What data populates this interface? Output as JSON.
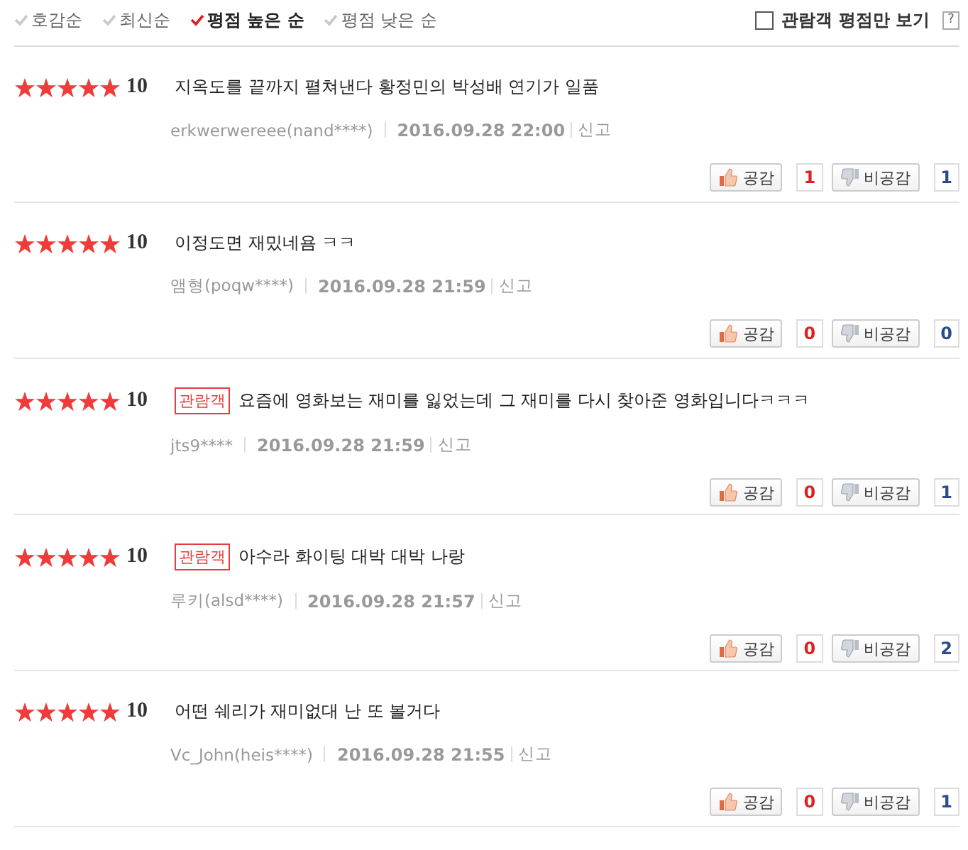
{
  "sort_options": [
    {
      "label": "호감순",
      "selected": false
    },
    {
      "label": "최신순",
      "selected": false
    },
    {
      "label": "평점 높은 순",
      "selected": true
    },
    {
      "label": "평점 낮은 순",
      "selected": false
    }
  ],
  "filter": {
    "label": "관람객 평점만 보기",
    "checked": false,
    "help": "?"
  },
  "reviews": [
    {
      "stars": 5,
      "score": "10",
      "text": "지옥도를 끝까지 펼쳐낸다 황정민의 박성배 연기가 일품",
      "author": "erkwerwereee(nand****)",
      "date": "2016.09.28 22:00",
      "report": "신고",
      "like_label": "공감",
      "likes": "1",
      "dislike_label": "비공감",
      "dislikes": "1"
    },
    {
      "stars": 5,
      "score": "10",
      "text": "이정도면 재밌네욤 ㅋㅋ",
      "author": "앰형(poqw****)",
      "date": "2016.09.28 21:59",
      "report": "신고",
      "like_label": "공감",
      "likes": "0",
      "dislike_label": "비공감",
      "dislikes": "0"
    },
    {
      "stars": 5,
      "score": "10",
      "badge": "관람객",
      "text": "요즘에 영화보는 재미를 잃었는데 그 재미를 다시 찾아준 영화입니다ㅋㅋㅋ",
      "author": "jts9****",
      "date": "2016.09.28 21:59",
      "report": "신고",
      "like_label": "공감",
      "likes": "0",
      "dislike_label": "비공감",
      "dislikes": "1"
    },
    {
      "stars": 5,
      "score": "10",
      "badge": "관람객",
      "text": "아수라 화이팅 대박 대박 나랑",
      "author": "루키(alsd****)",
      "date": "2016.09.28 21:57",
      "report": "신고",
      "like_label": "공감",
      "likes": "0",
      "dislike_label": "비공감",
      "dislikes": "2"
    },
    {
      "stars": 5,
      "score": "10",
      "text": "어떤 쉐리가 재미없대 난 또 볼거다",
      "author": "Vc_John(heis****)",
      "date": "2016.09.28 21:55",
      "report": "신고",
      "like_label": "공감",
      "likes": "0",
      "dislike_label": "비공감",
      "dislikes": "1"
    }
  ]
}
